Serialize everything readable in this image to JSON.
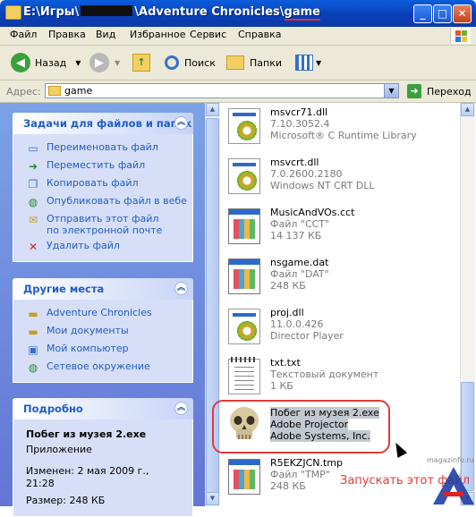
{
  "window": {
    "title_prefix": "E:\\Игры\\",
    "title_mid": "\\Adventure Chronicles\\",
    "title_suffix": "game",
    "btn_minimize": "_",
    "btn_maximize": "□",
    "btn_close": "✕"
  },
  "menu": [
    "Файл",
    "Правка",
    "Вид",
    "Избранное",
    "Сервис",
    "Справка"
  ],
  "toolbar": {
    "back": "Назад",
    "search": "Поиск",
    "folders": "Папки"
  },
  "address": {
    "label": "Адрес:",
    "value": "game",
    "go": "Переход"
  },
  "tasks": {
    "title": "Задачи для файлов и папок",
    "items": [
      {
        "label": "Переименовать файл",
        "icon": "rename-icon"
      },
      {
        "label": "Переместить файл",
        "icon": "move-icon"
      },
      {
        "label": "Копировать файл",
        "icon": "copy-icon"
      },
      {
        "label": "Опубликовать файл в вебе",
        "icon": "globe-icon"
      },
      {
        "label": "Отправить этот файл по электронной почте",
        "icon": "mail-icon"
      },
      {
        "label": "Удалить файл",
        "icon": "delete-icon"
      }
    ]
  },
  "places": {
    "title": "Другие места",
    "items": [
      {
        "label": "Adventure Chronicles",
        "icon": "folder-icon"
      },
      {
        "label": "Мои документы",
        "icon": "folder-icon"
      },
      {
        "label": "Мой компьютер",
        "icon": "computer-icon"
      },
      {
        "label": "Сетевое окружение",
        "icon": "network-icon"
      }
    ]
  },
  "details": {
    "title": "Подробно",
    "name": "Побег из музея 2.exe",
    "type": "Приложение",
    "modified": "Изменен: 2 мая 2009 г., 21:28",
    "size": "Размер: 248 КБ"
  },
  "files": [
    {
      "name": "msvcr71.dll",
      "l2": "7.10.3052.4",
      "l3": "Microsoft® C Runtime Library",
      "icon": "dll-gear-icon"
    },
    {
      "name": "msvcrt.dll",
      "l2": "7.0.2600.2180",
      "l3": "Windows NT CRT DLL",
      "icon": "dll-gear-icon"
    },
    {
      "name": "MusicAndVOs.cct",
      "l2": "Файл \"CCT\"",
      "l3": "14 137 КБ",
      "icon": "app-window-icon"
    },
    {
      "name": "nsgame.dat",
      "l2": "Файл \"DAT\"",
      "l3": "248 КБ",
      "icon": "app-window-icon"
    },
    {
      "name": "proj.dll",
      "l2": "11.0.0.426",
      "l3": "Director Player",
      "icon": "dll-gear-icon"
    },
    {
      "name": "txt.txt",
      "l2": "Текстовый документ",
      "l3": "1 КБ",
      "icon": "text-document-icon"
    },
    {
      "name": "Побег из музея 2.exe",
      "l2": "Adobe Projector",
      "l3": "Adobe Systems, Inc.",
      "icon": "skull-icon"
    },
    {
      "name": "R5EKZJCN.tmp",
      "l2": "Файл \"TMP\"",
      "l3": "248 КБ",
      "icon": "app-window-icon"
    }
  ],
  "annotation": {
    "caption": "Запускать этот файл",
    "watermark": "magazinfo.ru"
  }
}
